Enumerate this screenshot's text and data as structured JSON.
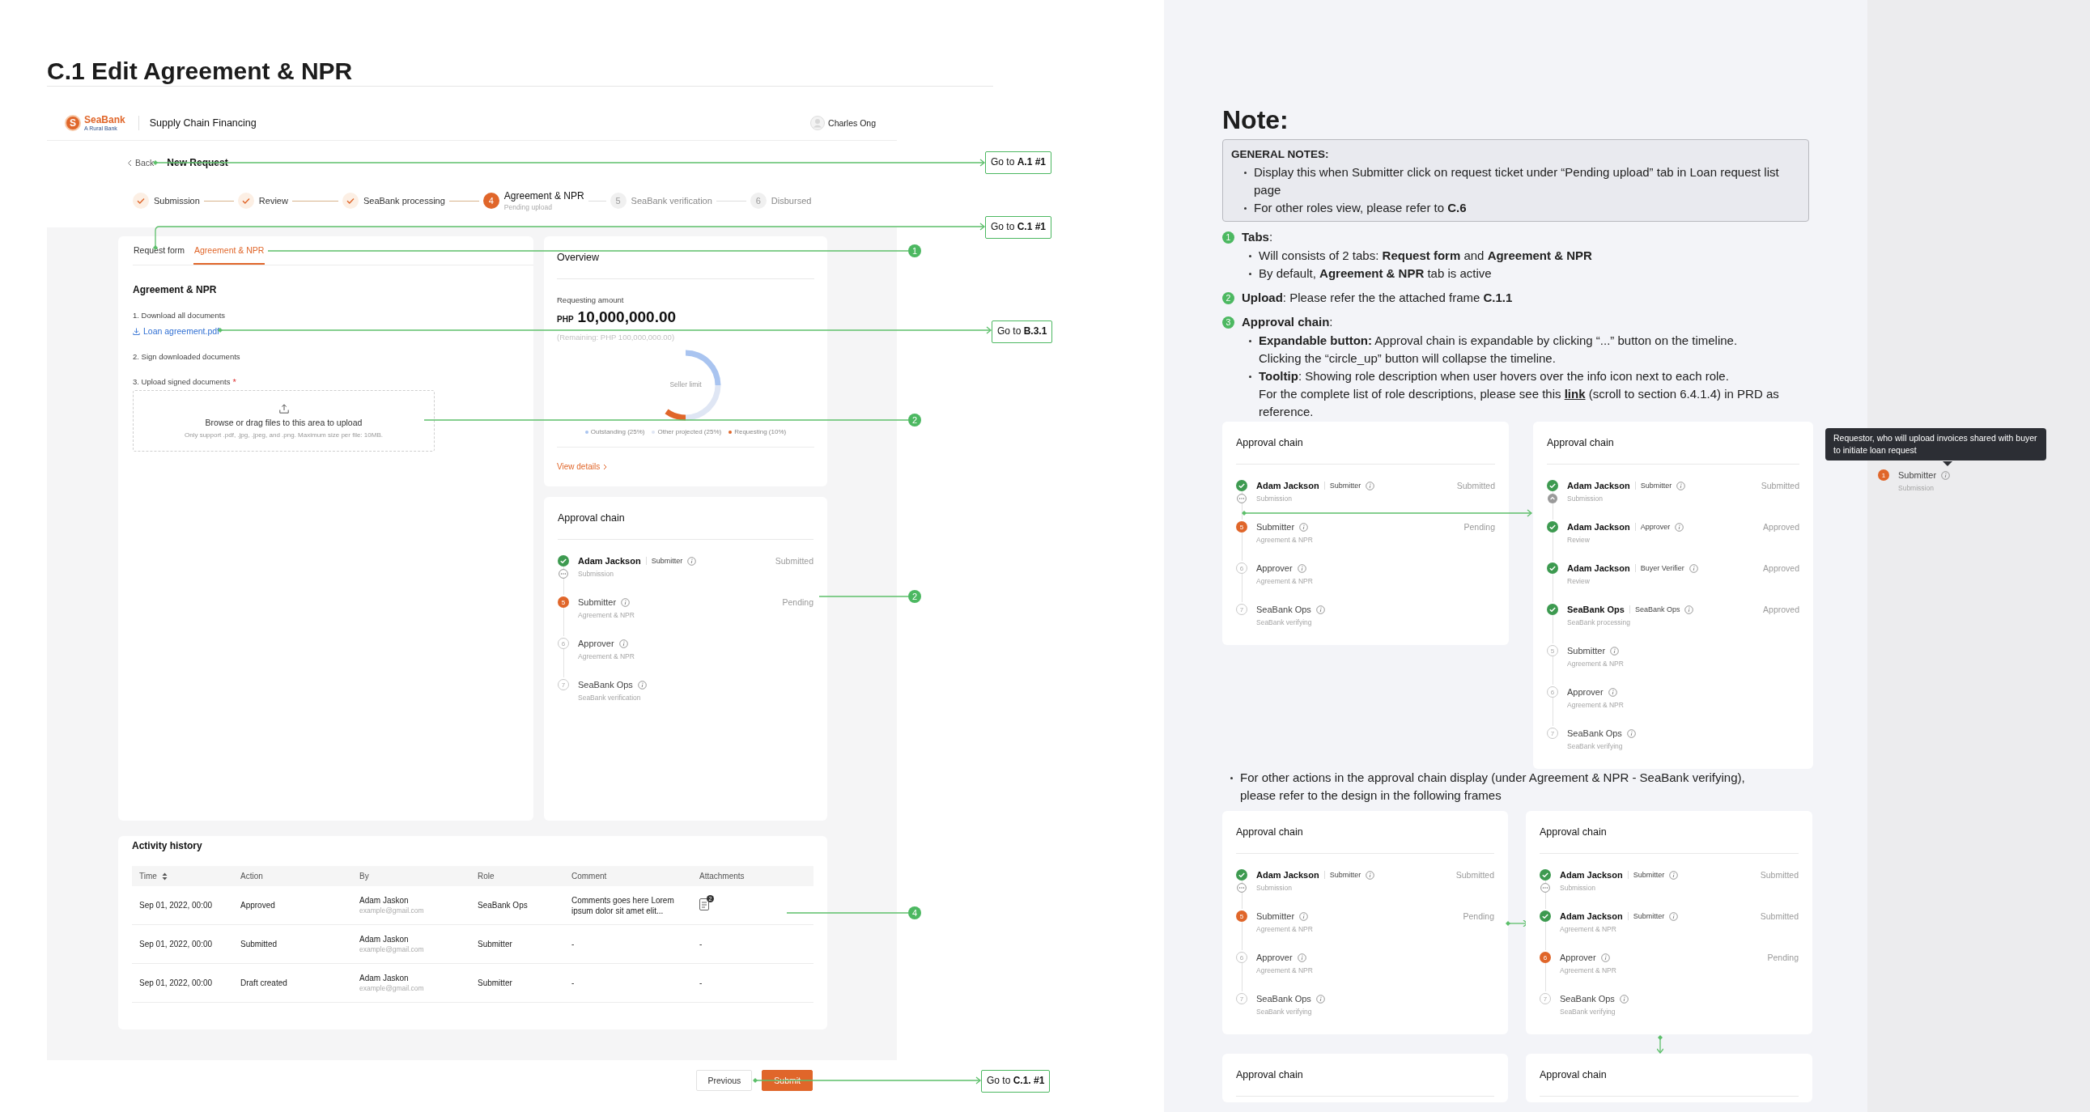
{
  "page_title": "C.1 Edit Agreement & NPR",
  "app": {
    "logo": {
      "mark": "S",
      "name": "SeaBank",
      "tagline": "A Rural Bank"
    },
    "product": "Supply Chain Financing",
    "user": "Charles Ong",
    "back": "Back",
    "page_heading": "New Request",
    "steps": [
      {
        "kind": "done",
        "label": "Submission"
      },
      {
        "kind": "done",
        "label": "Review"
      },
      {
        "kind": "done",
        "label": "SeaBank processing"
      },
      {
        "kind": "current",
        "number": "4",
        "label": "Agreement & NPR",
        "sublabel": "Pending upload"
      },
      {
        "kind": "upcoming",
        "number": "5",
        "label": "SeaBank verification"
      },
      {
        "kind": "upcoming",
        "number": "6",
        "label": "Disbursed"
      }
    ],
    "tabs": [
      {
        "label": "Request form",
        "selected": false
      },
      {
        "label": "Agreement & NPR",
        "selected": true
      }
    ],
    "form": {
      "heading": "Agreement & NPR",
      "step_1": "1. Download all documents",
      "file_link": "Loan agreement.pdf",
      "step_2": "2. Sign downloaded documents",
      "step_3": "3. Upload signed documents",
      "required_mark": "*",
      "upload_title": "Browse or drag files to this area to upload",
      "upload_hint": "Only support .pdf, .jpg, .jpeg, and .png. Maximum size per file: 10MB."
    },
    "overview": {
      "title": "Overview",
      "amount_label": "Requesting amount",
      "currency": "PHP",
      "amount": "10,000,000.00",
      "remaining": "(Remaining: PHP 100,000,000.00)",
      "chart_data": {
        "type": "donut",
        "title": "Seller limit",
        "categories": [
          "Outstanding (25%)",
          "Other projected (25%)",
          "Requesting (10%)"
        ],
        "colors": [
          "#a9c4f0",
          "#dfe6f4",
          "#e0662a"
        ],
        "series": [
          {
            "values": [
              25,
              25,
              10
            ]
          }
        ],
        "legend": "bottom"
      },
      "link": "View details"
    },
    "approval_chain": {
      "title": "Approval chain",
      "items": [
        {
          "kind": "done",
          "name": "Adam Jackson",
          "role": "Submitter",
          "stage": "Submission",
          "status": "Submitted",
          "toggle": {
            "kind": "expand"
          }
        },
        {
          "kind": "current",
          "number": "5",
          "name": "Submitter",
          "stage": "Agreement & NPR",
          "status": "Pending"
        },
        {
          "kind": "upcoming",
          "number": "6",
          "name": "Approver",
          "stage": "Agreement & NPR"
        },
        {
          "kind": "upcoming",
          "number": "7",
          "name": "SeaBank Ops",
          "stage": "SeaBank verification"
        }
      ]
    },
    "activity": {
      "title": "Activity history",
      "columns": [
        {
          "label": "Time",
          "sortable": true
        },
        {
          "label": "Action",
          "sortable": false
        },
        {
          "label": "By",
          "sortable": false
        },
        {
          "label": "Role",
          "sortable": false
        },
        {
          "label": "Comment",
          "sortable": false
        },
        {
          "label": "Attachments",
          "sortable": false
        }
      ],
      "rows": [
        {
          "time": "Sep 01, 2022, 00:00",
          "action": "Approved",
          "by": "Adam Jaskon",
          "email": "example@gmail.com",
          "role": "SeaBank Ops",
          "comment": "Comments goes here Lorem ipsum dolor sit amet elit...",
          "attachments": {
            "kind": "file",
            "count": "2"
          }
        },
        {
          "time": "Sep 01, 2022, 00:00",
          "action": "Submitted",
          "by": "Adam Jaskon",
          "email": "example@gmail.com",
          "role": "Submitter",
          "comment": "-",
          "attachments": {
            "kind": "text",
            "text": "-"
          }
        },
        {
          "time": "Sep 01, 2022, 00:00",
          "action": "Draft created",
          "by": "Adam Jaskon",
          "email": "example@gmail.com",
          "role": "Submitter",
          "comment": "-",
          "attachments": {
            "kind": "text",
            "text": "-"
          }
        }
      ]
    },
    "footer": {
      "previous": "Previous",
      "submit": "Submit"
    }
  },
  "annotations": {
    "links": [
      {
        "text": "Go to **A.1 #1**"
      },
      {
        "text": "Go to **C.1 #1**"
      },
      {
        "text": "Go to **B.3.1**"
      },
      {
        "text": "Go to **C.1. #1**"
      }
    ],
    "markers": [
      "1",
      "2",
      "2",
      "4"
    ]
  },
  "note": {
    "title": "Note:",
    "general": {
      "heading": "GENERAL NOTES:",
      "bullets": [
        "Display this when Submitter click on request ticket under “Pending upload” tab in Loan request list page",
        "For other roles view, please refer to **C.6**"
      ]
    },
    "items": [
      {
        "number": "1",
        "text": "**Tabs**:",
        "bullets": [
          {
            "text": "Will consists of 2 tabs: **Request form** and **Agreement & NPR**"
          },
          {
            "text": "By default, **Agreement & NPR** tab is active"
          }
        ]
      },
      {
        "number": "2",
        "text": "**Upload**: Please refer the the attached frame **C.1.1**"
      },
      {
        "number": "3",
        "text": "**Approval chain**:",
        "bullets": [
          {
            "text": "**Expandable button:** Approval chain is expandable by clicking “...” button on the timeline.\nClicking the “circle_up” button will collapse the timeline."
          },
          {
            "text": "**Tooltip**: Showing role description when user hovers over the info icon next to each role.\nFor the complete list of role descriptions, please see this ",
            "link": "link",
            "text_after": " (scroll to section 6.4.1.4) in PRD as reference."
          }
        ]
      }
    ],
    "frames": [
      {
        "title": "Approval chain",
        "items": [
          {
            "kind": "done",
            "name": "Adam Jackson",
            "role": "Submitter",
            "stage": "Submission",
            "status": "Submitted",
            "toggle": {
              "kind": "expand"
            }
          },
          {
            "kind": "current",
            "number": "5",
            "name": "Submitter",
            "stage": "Agreement & NPR",
            "status": "Pending"
          },
          {
            "kind": "upcoming",
            "number": "6",
            "name": "Approver",
            "stage": "Agreement & NPR"
          },
          {
            "kind": "upcoming",
            "number": "7",
            "name": "SeaBank Ops",
            "stage": "SeaBank verifying"
          }
        ]
      },
      {
        "title": "Approval chain",
        "items": [
          {
            "kind": "done",
            "name": "Adam Jackson",
            "role": "Submitter",
            "stage": "Submission",
            "status": "Submitted",
            "toggle": {
              "kind": "collapse"
            }
          },
          {
            "kind": "done",
            "name": "Adam Jackson",
            "role": "Approver",
            "stage": "Review",
            "status": "Approved"
          },
          {
            "kind": "done",
            "name": "Adam Jackson",
            "role": "Buyer Verifier",
            "stage": "Review",
            "status": "Approved"
          },
          {
            "kind": "done",
            "name": "SeaBank Ops",
            "role": "SeaBank Ops",
            "stage": "SeaBank processing",
            "status": "Approved"
          },
          {
            "kind": "upcoming",
            "number": "5",
            "name": "Submitter",
            "stage": "Agreement & NPR"
          },
          {
            "kind": "upcoming",
            "number": "6",
            "name": "Approver",
            "stage": "Agreement & NPR"
          },
          {
            "kind": "upcoming",
            "number": "7",
            "name": "SeaBank Ops",
            "stage": "SeaBank verifying"
          }
        ]
      }
    ],
    "tooltip": {
      "text": "Requestor, who will upload invoices shared with buyer\nto initiate loan request",
      "item": {
        "kind": "current",
        "number": "1",
        "name": "Submitter",
        "stage": "Submission"
      }
    },
    "other_actions": "For other actions in the approval chain display (under Agreement & NPR - SeaBank verifying),\nplease refer to the design in the following frames",
    "more_frames": [
      {
        "title": "Approval chain",
        "items": [
          {
            "kind": "done",
            "name": "Adam Jackson",
            "role": "Submitter",
            "stage": "Submission",
            "status": "Submitted",
            "toggle": {
              "kind": "expand"
            }
          },
          {
            "kind": "current",
            "number": "5",
            "name": "Submitter",
            "stage": "Agreement & NPR",
            "status": "Pending"
          },
          {
            "kind": "upcoming",
            "number": "6",
            "name": "Approver",
            "stage": "Agreement & NPR"
          },
          {
            "kind": "upcoming",
            "number": "7",
            "name": "SeaBank Ops",
            "stage": "SeaBank verifying"
          }
        ]
      },
      {
        "title": "Approval chain",
        "items": [
          {
            "kind": "done",
            "name": "Adam Jackson",
            "role": "Submitter",
            "stage": "Submission",
            "status": "Submitted",
            "toggle": {
              "kind": "expand"
            }
          },
          {
            "kind": "done",
            "name": "Adam Jackson",
            "role": "Submitter",
            "stage": "Agreement & NPR",
            "status": "Submitted"
          },
          {
            "kind": "current",
            "number": "6",
            "name": "Approver",
            "stage": "Agreement & NPR",
            "status": "Pending"
          },
          {
            "kind": "upcoming",
            "number": "7",
            "name": "SeaBank Ops",
            "stage": "SeaBank verifying"
          }
        ]
      },
      {
        "title": "Approval chain"
      },
      {
        "title": "Approval chain"
      }
    ]
  }
}
